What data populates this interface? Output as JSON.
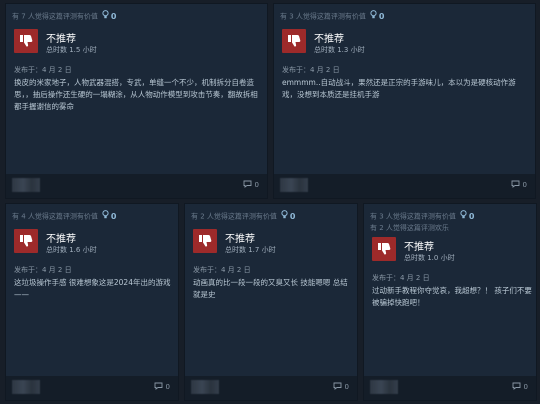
{
  "reviews": [
    {
      "helpful_lines": [
        "有 7 人觉得这篇评测有价值"
      ],
      "helpful_count": "0",
      "verdict": "不推荐",
      "hours": "总时数 1.5 小时",
      "posted": "发布于：4 月 2 日",
      "content": "换皮的米家地子，人物武器混搭，专武，单缝一个不少，机制拆分自卷造思，，抽后操作还生硬的一塌糊涂，从人物动作模型到攻击节奏，翻故拆相都手握谢信的雾命",
      "comments": "0"
    },
    {
      "helpful_lines": [
        "有 3 人觉得这篇评测有价值"
      ],
      "helpful_count": "0",
      "verdict": "不推荐",
      "hours": "总时数 1.3 小时",
      "posted": "发布于：4 月 2 日",
      "content": "emmmm..自动战斗，果然还是正宗的手游味儿，本以为是硬核动作游戏，没想到本质还是挂机手游",
      "comments": "0"
    },
    {
      "helpful_lines": [
        "有 4 人觉得这篇评测有价值"
      ],
      "helpful_count": "0",
      "verdict": "不推荐",
      "hours": "总时数 1.6 小时",
      "posted": "发布于：4 月 2 日",
      "content": "这垃圾操作手感 很难想象这是2024年出的游戏——",
      "comments": "0"
    },
    {
      "helpful_lines": [
        "有 2 人觉得这篇评测有价值"
      ],
      "helpful_count": "0",
      "verdict": "不推荐",
      "hours": "总时数 1.7 小时",
      "posted": "发布于：4 月 2 日",
      "content": "动画真的比一段一段的又臭又长 技能嗯嗯 总结就是史",
      "comments": "0"
    },
    {
      "helpful_lines": [
        "有 3 人觉得这篇评测有价值",
        "有 2 人觉得这篇评测欢乐"
      ],
      "helpful_count": "0",
      "verdict": "不推荐",
      "hours": "总时数 1.0 小时",
      "posted": "发布于：4 月 2 日",
      "content": "过动新手教程你夺觉哀，我超想？！ 孩子们不要被骗掉快跑吧！",
      "comments": "0"
    }
  ],
  "colors": {
    "background": "#171e28",
    "card": "#1b2838",
    "thumb_red": "#9d2a2a",
    "helpful_blue": "#8fb8d6"
  },
  "icons": {
    "helpful": "lightbulb-icon",
    "verdict": "thumbs-down-icon",
    "comments": "comment-bubble-icon"
  }
}
